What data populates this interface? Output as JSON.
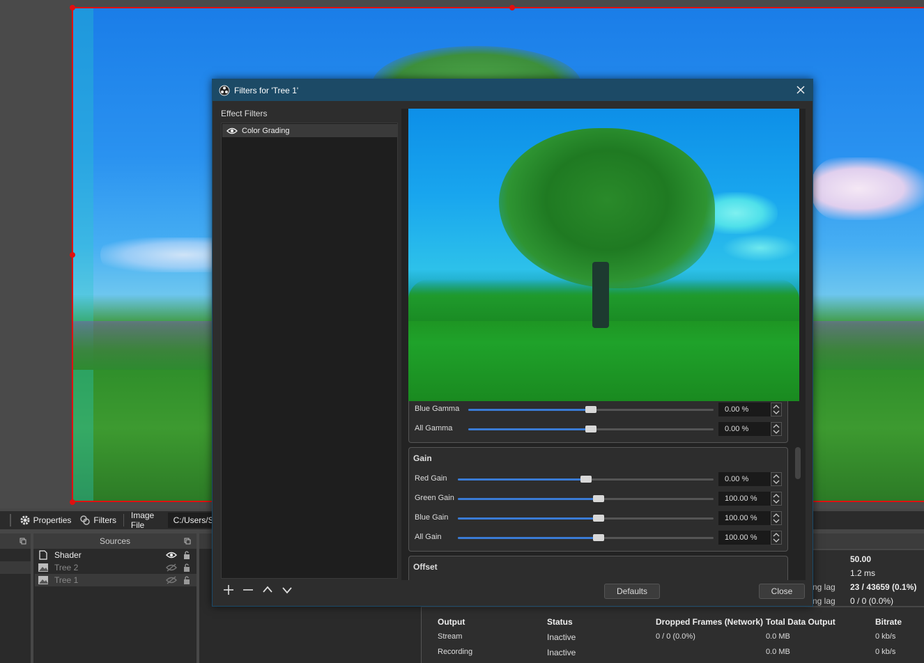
{
  "toolbar": {
    "properties_label": "Properties",
    "filters_label": "Filters",
    "image_file_label": "Image File",
    "path_value": "C:/Users/Seb"
  },
  "docks": {
    "sources_title": "Sources"
  },
  "sources": [
    {
      "name": "Shader",
      "visible": true
    },
    {
      "name": "Tree 2",
      "visible": false
    },
    {
      "name": "Tree 1",
      "visible": false
    }
  ],
  "stats": {
    "fps": "50.00",
    "render_time": "1.2 ms",
    "lag_label_1": "ng lag",
    "lag_value_1": "23 / 43659 (0.1%)",
    "lag_label_2": "ng lag",
    "lag_value_2": "0 / 0 (0.0%)"
  },
  "output_table": {
    "headers": [
      "Output",
      "Status",
      "Dropped Frames (Network)",
      "Total Data Output",
      "Bitrate"
    ],
    "rows": [
      {
        "output": "Stream",
        "status": "Inactive",
        "dropped": "0 / 0 (0.0%)",
        "total": "0.0 MB",
        "bitrate": "0 kb/s"
      },
      {
        "output": "Recording",
        "status": "Inactive",
        "dropped": "",
        "total": "0.0 MB",
        "bitrate": "0 kb/s"
      }
    ]
  },
  "dialog": {
    "title": "Filters for 'Tree 1'",
    "effect_filters_label": "Effect Filters",
    "filters": [
      {
        "name": "Color Grading"
      }
    ],
    "defaults_label": "Defaults",
    "close_label": "Close",
    "gamma_rows": [
      {
        "label": "Blue Gamma",
        "value": "0.00 %",
        "fraction": 0.5
      },
      {
        "label": "All Gamma",
        "value": "0.00 %",
        "fraction": 0.5
      }
    ],
    "gain_group": {
      "title": "Gain",
      "rows": [
        {
          "label": "Red Gain",
          "value": "0.00 %",
          "fraction": 0.5
        },
        {
          "label": "Green Gain",
          "value": "100.00 %",
          "fraction": 0.55
        },
        {
          "label": "Blue Gain",
          "value": "100.00 %",
          "fraction": 0.55
        },
        {
          "label": "All Gain",
          "value": "100.00 %",
          "fraction": 0.55
        }
      ]
    },
    "offset_group": {
      "title": "Offset"
    }
  },
  "colors": {
    "accent": "#3a7bd5",
    "selection": "#e01010",
    "dialog_title_bar": "#1c4a66"
  }
}
